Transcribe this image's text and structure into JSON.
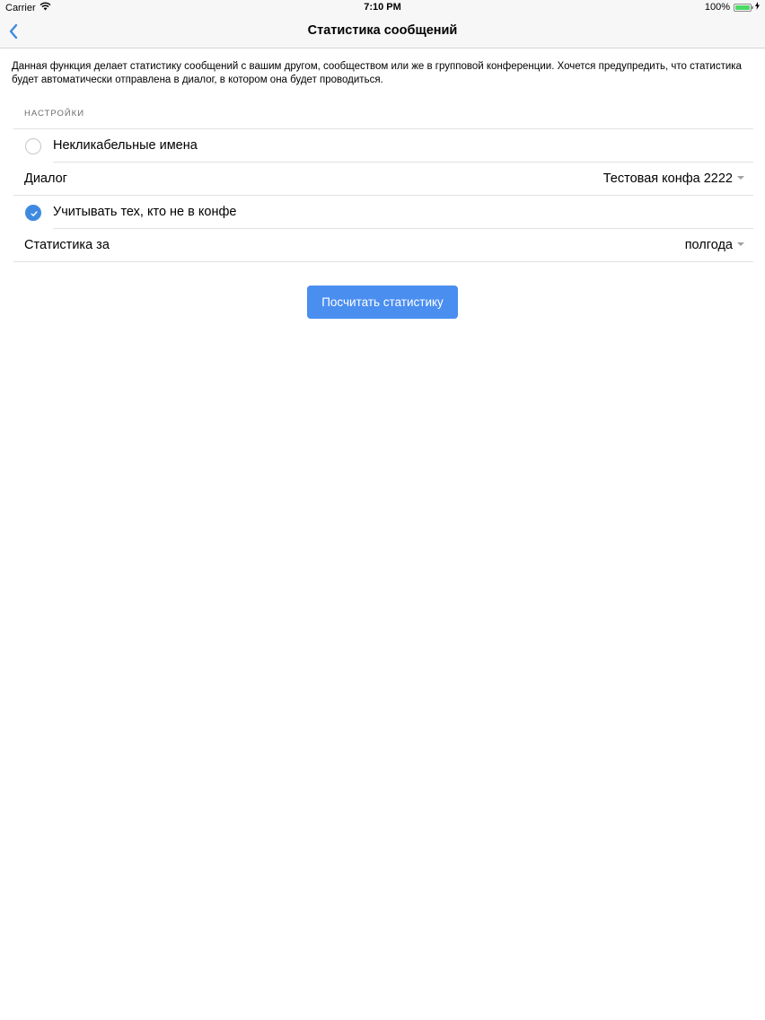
{
  "status_bar": {
    "carrier": "Carrier",
    "time": "7:10 PM",
    "battery_percent": "100%",
    "battery_level": 1.0,
    "wifi_icon": "wifi-icon",
    "charging_icon": "bolt-icon"
  },
  "nav": {
    "title": "Статистика сообщений",
    "back_icon": "chevron-left-icon"
  },
  "description": "Данная функция делает статистику сообщений с вашим другом, сообществом или же в групповой конференции. Хочется предупредить, что статистика будет автоматически отправлена в диалог, в котором она будет проводиться.",
  "settings": {
    "header": "НАСТРОЙКИ",
    "unclickable_names": {
      "label": "Некликабельные имена",
      "checked": false
    },
    "dialog": {
      "label": "Диалог",
      "value": "Тестовая конфа 2222"
    },
    "count_absent": {
      "label": "Учитывать тех, кто не в конфе",
      "checked": true
    },
    "period": {
      "label": "Статистика за",
      "value": "полгода"
    }
  },
  "actions": {
    "calculate_label": "Посчитать статистику"
  },
  "colors": {
    "accent": "#4a8ef0",
    "check_blue": "#3f8ae0",
    "battery_green": "#4cd964",
    "nav_background": "#f7f7f8",
    "separator": "#e1e1e4",
    "section_header": "#6d6d72"
  }
}
